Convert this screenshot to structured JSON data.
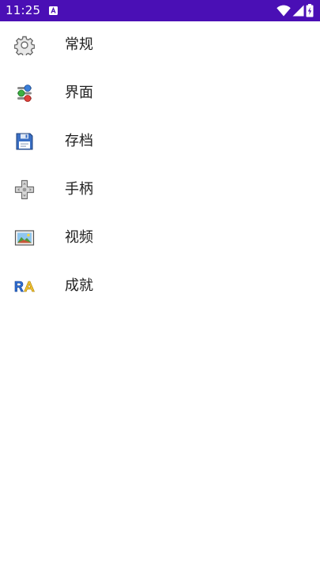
{
  "status_bar": {
    "time": "11:25",
    "background_color": "#4a0fb5",
    "icons": [
      "keyboard-a-icon",
      "wifi-icon",
      "signal-icon",
      "battery-charging-icon"
    ]
  },
  "menu": {
    "items": [
      {
        "label": "常规",
        "icon": "gear-icon"
      },
      {
        "label": "界面",
        "icon": "toggles-icon"
      },
      {
        "label": "存档",
        "icon": "floppy-disk-icon"
      },
      {
        "label": "手柄",
        "icon": "dpad-icon"
      },
      {
        "label": "视频",
        "icon": "picture-icon"
      },
      {
        "label": "成就",
        "icon": "retroachievements-icon"
      }
    ]
  }
}
